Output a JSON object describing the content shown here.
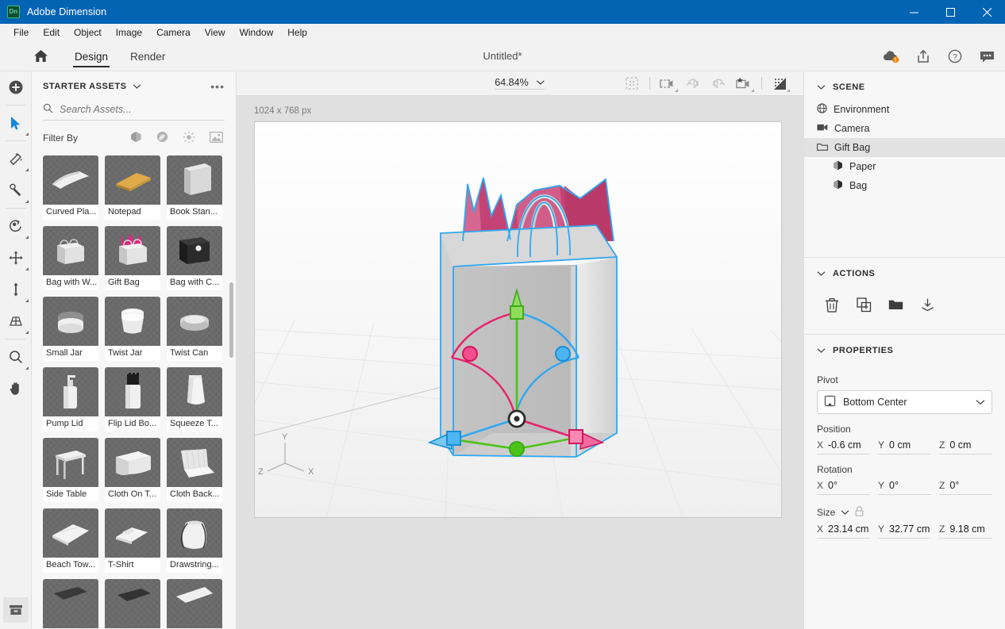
{
  "window": {
    "app_title": "Adobe Dimension",
    "logo_text": "Dn",
    "minimize": "minimize-button",
    "maximize": "maximize-button",
    "close": "close-button"
  },
  "menubar": {
    "items": [
      "File",
      "Edit",
      "Object",
      "Image",
      "Camera",
      "View",
      "Window",
      "Help"
    ]
  },
  "header": {
    "home": "home-icon",
    "tabs": [
      {
        "label": "Design",
        "active": true
      },
      {
        "label": "Render",
        "active": false
      }
    ],
    "document_title": "Untitled*",
    "icons": [
      "cloud-sync-icon",
      "share-icon",
      "help-icon",
      "feedback-icon"
    ]
  },
  "toolrail": {
    "tools": [
      {
        "name": "add-object-tool",
        "selected": false
      },
      {
        "name": "select-tool",
        "selected": false
      },
      {
        "name": "magic-wand-tool",
        "selected": false
      },
      {
        "name": "sampler-eyedropper-tool",
        "selected": false
      },
      {
        "name": "orbit-tool",
        "selected": false
      },
      {
        "name": "move-tool",
        "selected": false
      },
      {
        "name": "scale-tool",
        "selected": false
      },
      {
        "name": "horizon-tool",
        "selected": false
      },
      {
        "name": "zoom-tool",
        "selected": false
      },
      {
        "name": "pan-hand-tool",
        "selected": false
      }
    ],
    "bottom": "content-library-button"
  },
  "assets": {
    "panel_title": "STARTER ASSETS",
    "more_menu": "•••",
    "search": {
      "placeholder": "Search Assets...",
      "value": ""
    },
    "filter_label": "Filter By",
    "filter_icons": [
      "model-filter-icon",
      "material-filter-icon",
      "light-filter-icon",
      "image-filter-icon"
    ],
    "items": [
      {
        "label": "Curved Pla...",
        "art": "plane"
      },
      {
        "label": "Notepad",
        "art": "notepad"
      },
      {
        "label": "Book Stan...",
        "art": "book"
      },
      {
        "label": "Bag with W...",
        "art": "bag-handles"
      },
      {
        "label": "Gift Bag",
        "art": "gift-bag"
      },
      {
        "label": "Bag with C...",
        "art": "bag-dark"
      },
      {
        "label": "Small Jar",
        "art": "small-jar"
      },
      {
        "label": "Twist Jar",
        "art": "twist-jar"
      },
      {
        "label": "Twist Can",
        "art": "twist-can"
      },
      {
        "label": "Pump Lid",
        "art": "pump-lid"
      },
      {
        "label": "Flip Lid Bo...",
        "art": "flip-lid"
      },
      {
        "label": "Squeeze T...",
        "art": "squeeze-tube"
      },
      {
        "label": "Side Table",
        "art": "side-table"
      },
      {
        "label": "Cloth On T...",
        "art": "cloth-table"
      },
      {
        "label": "Cloth Back...",
        "art": "cloth-backdrop"
      },
      {
        "label": "Beach Tow...",
        "art": "beach-towel"
      },
      {
        "label": "T-Shirt",
        "art": "tshirt"
      },
      {
        "label": "Drawstring...",
        "art": "drawstring-bag"
      }
    ]
  },
  "canvas": {
    "zoom_level": "64.84%",
    "zoom_caret": "chevron-down-icon",
    "toolbar_icons": [
      "render-preview-icon",
      "camera-bookmark-icon",
      "camera-undo-icon",
      "camera-redo-icon",
      "camera-default-icon",
      "render-quality-icon"
    ],
    "size_label": "1024 x 768 px",
    "axis_labels": {
      "x": "X",
      "y": "Y",
      "z": "Z"
    }
  },
  "scene": {
    "section_title": "SCENE",
    "items": [
      {
        "label": "Environment",
        "icon": "globe-icon",
        "selected": false,
        "child": false
      },
      {
        "label": "Camera",
        "icon": "camera-icon",
        "selected": false,
        "child": false
      },
      {
        "label": "Gift Bag",
        "icon": "group-folder-icon",
        "selected": true,
        "child": false
      },
      {
        "label": "Paper",
        "icon": "model-icon",
        "selected": false,
        "child": true
      },
      {
        "label": "Bag",
        "icon": "model-icon",
        "selected": false,
        "child": true
      }
    ]
  },
  "actions": {
    "section_title": "ACTIONS",
    "buttons": [
      "delete-icon",
      "duplicate-icon",
      "group-icon",
      "unpack-icon"
    ]
  },
  "properties": {
    "section_title": "PROPERTIES",
    "pivot_label": "Pivot",
    "pivot_value": "Bottom Center",
    "position_label": "Position",
    "position": {
      "x": "-0.6 cm",
      "y": "0 cm",
      "z": "0 cm"
    },
    "rotation_label": "Rotation",
    "rotation": {
      "x": "0°",
      "y": "0°",
      "z": "0°"
    },
    "size_label": "Size",
    "size": {
      "x": "23.14 cm",
      "y": "32.77 cm",
      "z": "9.18 cm"
    },
    "axes": {
      "x": "X",
      "y": "Y",
      "z": "Z"
    }
  },
  "colors": {
    "titlebar": "#0464b4",
    "accent_selection": "#2fa8f0",
    "gizmo_x": "#e8226b",
    "gizmo_y": "#4cc417",
    "gizmo_z": "#2fa8f0",
    "panel_bg": "#f7f7f7",
    "workspace_bg": "#e0e0e0",
    "tissue_pink": "#c44272"
  }
}
